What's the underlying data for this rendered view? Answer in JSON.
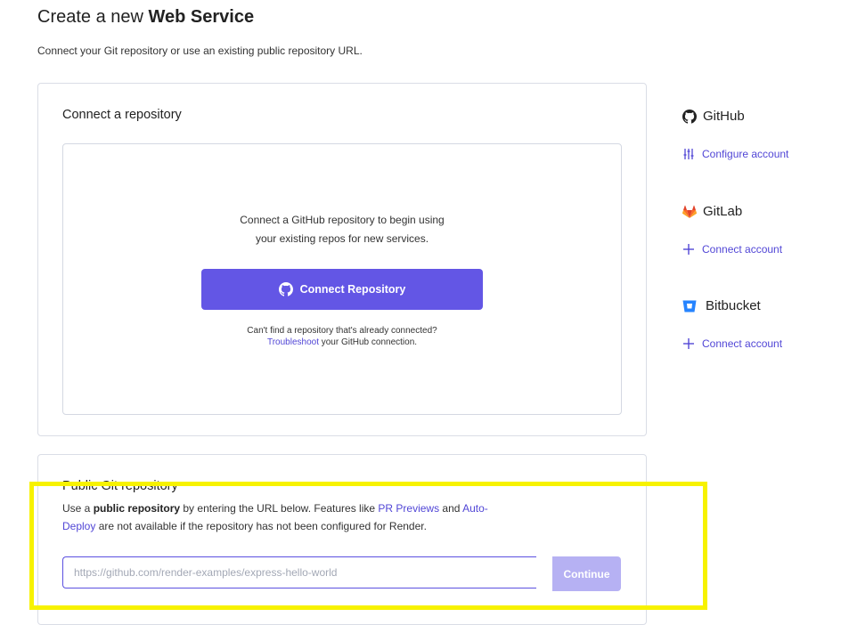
{
  "header": {
    "title_prefix": "Create a new ",
    "title_bold": "Web Service",
    "subtitle": "Connect your Git repository or use an existing public repository URL."
  },
  "connect_card": {
    "heading": "Connect a repository",
    "desc_line1": "Connect a GitHub repository to begin using",
    "desc_line2": "your existing repos for new services.",
    "button_label": "Connect Repository",
    "help_line1": "Can't find a repository that's already connected?",
    "help_link": "Troubleshoot",
    "help_rest": " your GitHub connection."
  },
  "providers": [
    {
      "name": "GitHub",
      "icon": "github-icon",
      "action": "Configure account",
      "action_icon": "sliders-icon"
    },
    {
      "name": "GitLab",
      "icon": "gitlab-icon",
      "action": "Connect account",
      "action_icon": "plus-icon"
    },
    {
      "name": "Bitbucket",
      "icon": "bitbucket-icon",
      "action": "Connect account",
      "action_icon": "plus-icon"
    }
  ],
  "public_card": {
    "heading": "Public Git repository",
    "text_use_a": "Use a ",
    "text_bold": "public repository",
    "text_mid": " by entering the URL below. Features like ",
    "link_pr": "PR Previews",
    "text_and": " and ",
    "link_auto": "Auto-Deploy",
    "text_end": " are not available if the repository has not been configured for Render.",
    "input_value": "",
    "input_placeholder": "https://github.com/render-examples/express-hello-world",
    "continue_label": "Continue"
  },
  "colors": {
    "accent": "#6356e5",
    "link": "#5146d6",
    "highlight": "#f7f200",
    "continue_disabled": "#b6b1f3"
  }
}
